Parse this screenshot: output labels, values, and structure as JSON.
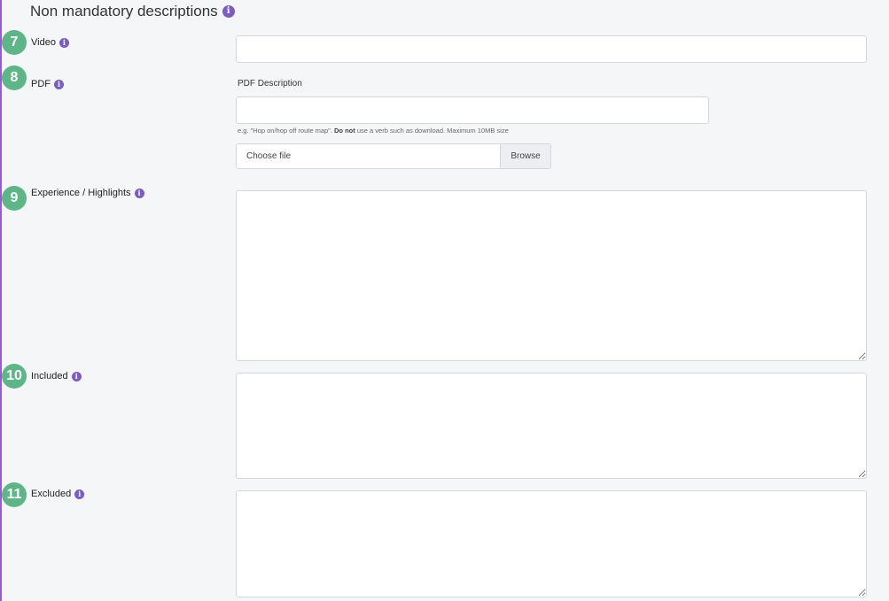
{
  "section": {
    "title": "Non mandatory descriptions"
  },
  "fields": {
    "video": {
      "step": "7",
      "label": "Video",
      "value": ""
    },
    "pdf": {
      "step": "8",
      "label": "PDF",
      "description_label": "PDF Description",
      "description_value": "",
      "hint_pre": "e.g. \"Hop on/hop off route map\". ",
      "hint_bold": "Do not",
      "hint_post": " use a verb such as download. Maximum 10MB size",
      "file_placeholder": "Choose file",
      "browse_label": "Browse"
    },
    "highlights": {
      "step": "9",
      "label": "Experience / Highlights",
      "value": ""
    },
    "included": {
      "step": "10",
      "label": "Included",
      "value": ""
    },
    "excluded": {
      "step": "11",
      "label": "Excluded",
      "value": ""
    }
  },
  "colors": {
    "accent": "#7b5bc4",
    "step_badge": "#5db588",
    "left_border": "#9b59d8"
  },
  "icons": {
    "info": "info-icon"
  }
}
